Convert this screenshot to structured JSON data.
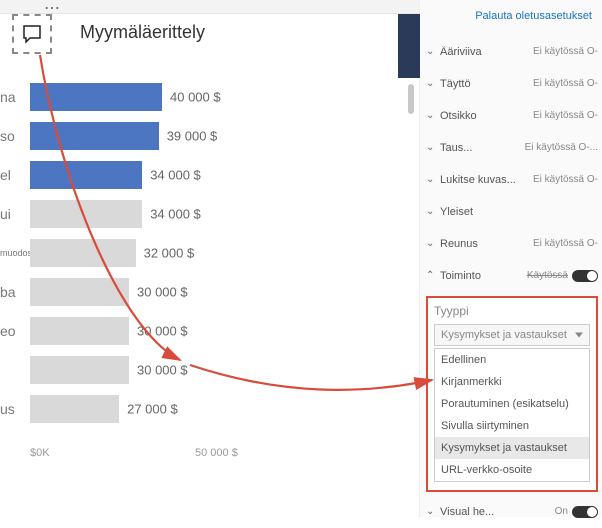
{
  "title": "Myymäläerittely",
  "restore_link": "Palauta oletusasetukset",
  "chart_data": {
    "type": "bar",
    "orientation": "horizontal",
    "categories": [
      "na",
      "so",
      "el",
      "ui",
      "muodossa",
      "ba",
      "eo",
      "",
      "us"
    ],
    "values": [
      40000,
      39000,
      34000,
      34000,
      32000,
      30000,
      30000,
      30000,
      27000
    ],
    "value_labels": [
      "40 000 $",
      "39 000 $",
      "34 000 $",
      "34 000 $",
      "32 000 $",
      "30 000 $",
      "30 000 $",
      "30 000 $",
      "27 000 $"
    ],
    "highlighted": [
      true,
      true,
      true,
      false,
      false,
      false,
      false,
      false,
      false
    ],
    "xlim": [
      0,
      100000
    ],
    "xticks": [
      {
        "label": "$0K",
        "pos": 0
      },
      {
        "label": "50 000 $",
        "pos": 50000
      }
    ]
  },
  "panel": {
    "items": [
      {
        "name": "Ääriviiva",
        "value": "Ei käytössä O-",
        "expanded": false
      },
      {
        "name": "Täyttö",
        "value": "Ei käytössä O-",
        "expanded": false
      },
      {
        "name": "Otsikko",
        "value": "Ei käytössä O-",
        "expanded": false
      },
      {
        "name": "Taus...",
        "value": "Ei käytössä O-...",
        "expanded": false
      },
      {
        "name": "Lukitse kuvas...",
        "value": "Ei käytössä O-",
        "expanded": false
      },
      {
        "name": "Yleiset",
        "value": "",
        "expanded": false
      },
      {
        "name": "Reunus",
        "value": "Ei käytössä O-",
        "expanded": false
      },
      {
        "name": "Toiminto",
        "value": "Käytössä",
        "expanded": true,
        "toggle": true
      }
    ],
    "type_label": "Tyyppi",
    "dropdown_value": "Kysymykset ja vastaukset",
    "dropdown_items": [
      "Edellinen",
      "Kirjanmerkki",
      "Porautuminen (esikatselu)",
      "Sivulla siirtyminen",
      "Kysymykset ja vastaukset",
      "URL-verkko-osoite"
    ],
    "dropdown_selected": 4
  },
  "footer": {
    "label": "Visual he...",
    "value": "On"
  }
}
